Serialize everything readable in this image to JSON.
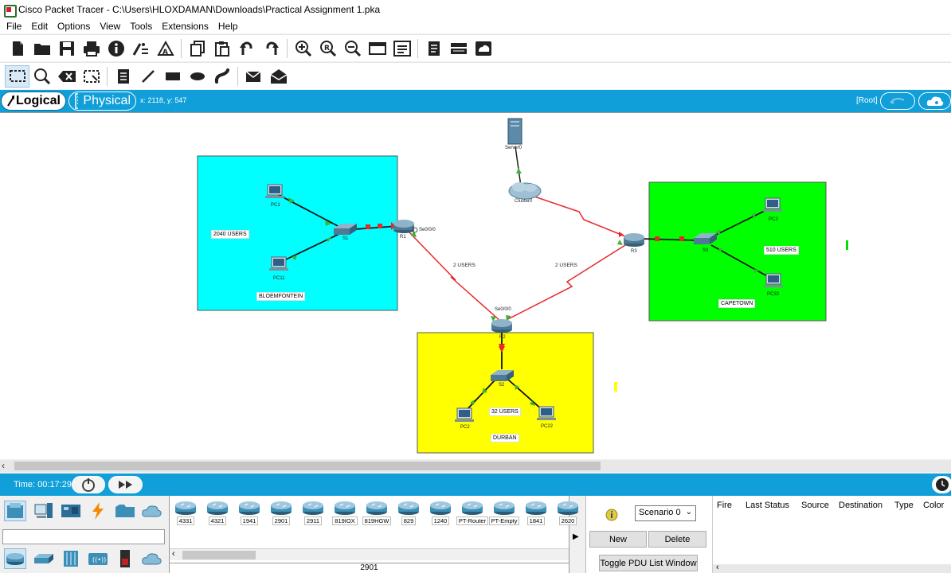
{
  "window": {
    "title": "Cisco Packet Tracer - C:\\Users\\HLOXDAMAN\\Downloads\\Practical Assignment 1.pka"
  },
  "menu": [
    "File",
    "Edit",
    "Options",
    "View",
    "Tools",
    "Extensions",
    "Help"
  ],
  "modebar": {
    "logical_label": "Logical",
    "physical_label": "Physical",
    "coords": "x: 2118, y: 547",
    "root_label": "[Root]"
  },
  "topology": {
    "areas": [
      {
        "label": "BLOEMFONTEIN",
        "color": "#00ffff"
      },
      {
        "label": "CAPETOWN",
        "color": "#00ff00"
      },
      {
        "label": "DURBAN",
        "color": "#ffff00"
      }
    ],
    "user_labels": {
      "bloem": "2040 USERS",
      "capetown": "510 USERS",
      "durban": "32 USERS",
      "link_r1_r2": "2 USERS",
      "link_r3_r2": "2 USERS"
    },
    "devices": {
      "server0": "Server0",
      "cluster0": "Cluster0",
      "pc1": "PC1",
      "pc11": "PC11",
      "s1": "S1",
      "r1": "R1",
      "r1_port": "Se0/0/0",
      "r3": "R3",
      "s3": "S3",
      "pc3": "PC3",
      "pc33": "PC33",
      "r2": "R2",
      "r2_port": "Se0/0/0",
      "s2": "S2",
      "pc2": "PC2",
      "pc22": "PC22"
    },
    "link_colors": {
      "serial": "#e8262a",
      "ethernet": "#000000",
      "up": "#3cb33c",
      "down": "#e8262a"
    }
  },
  "timebar": {
    "time": "Time: 00:17:29"
  },
  "device_models": [
    "4331",
    "4321",
    "1941",
    "2901",
    "2911",
    "819IOX",
    "819HGW",
    "829",
    "1240",
    "PT-Router",
    "PT-Empty",
    "1841",
    "2620"
  ],
  "selected_model": "2901",
  "scenario": {
    "selected": "Scenario 0",
    "new_label": "New",
    "delete_label": "Delete",
    "toggle_label": "Toggle PDU List Window"
  },
  "pdu_columns": [
    "Fire",
    "Last Status",
    "Source",
    "Destination",
    "Type",
    "Color"
  ]
}
